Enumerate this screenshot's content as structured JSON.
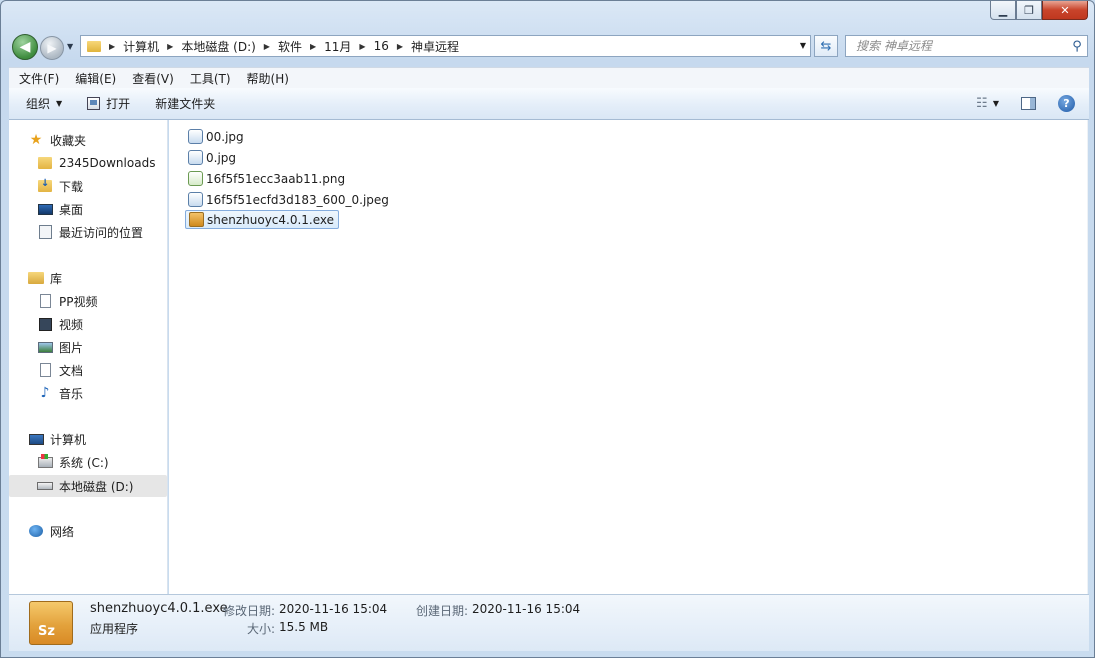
{
  "window": {
    "breadcrumb": [
      "计算机",
      "本地磁盘 (D:)",
      "软件",
      "11月",
      "16",
      "神卓远程"
    ],
    "search_placeholder": "搜索 神卓远程"
  },
  "menubar": [
    "文件(F)",
    "编辑(E)",
    "查看(V)",
    "工具(T)",
    "帮助(H)"
  ],
  "toolbar": {
    "organize": "组织",
    "open": "打开",
    "new_folder": "新建文件夹"
  },
  "nav": {
    "favorites": "收藏夹",
    "fav_items": [
      "2345Downloads",
      "下载",
      "桌面",
      "最近访问的位置"
    ],
    "libraries": "库",
    "lib_items": [
      "PP视频",
      "视频",
      "图片",
      "文档",
      "音乐"
    ],
    "computer": "计算机",
    "drives": [
      "系统 (C:)",
      "本地磁盘 (D:)"
    ],
    "network": "网络"
  },
  "files": [
    {
      "name": "00.jpg",
      "type": "jpg-icon"
    },
    {
      "name": "0.jpg",
      "type": "jpg-icon"
    },
    {
      "name": "16f5f51ecc3aab11.png",
      "type": "png-icon"
    },
    {
      "name": "16f5f51ecfd3d183_600_0.jpeg",
      "type": "jpg-icon"
    },
    {
      "name": "shenzhuoyc4.0.1.exe",
      "type": "exe-icon",
      "selected": true
    }
  ],
  "details": {
    "icon_text": "Sz",
    "filename": "shenzhuoyc4.0.1.exe",
    "filetype": "应用程序",
    "modified_label": "修改日期:",
    "modified_value": "2020-11-16 15:04",
    "created_label": "创建日期:",
    "created_value": "2020-11-16 15:04",
    "size_label": "大小:",
    "size_value": "15.5 MB"
  },
  "colors": {
    "accent": "#3a7bd5",
    "selection_border": "#84acdd",
    "window_frame": "#c9dcef"
  }
}
